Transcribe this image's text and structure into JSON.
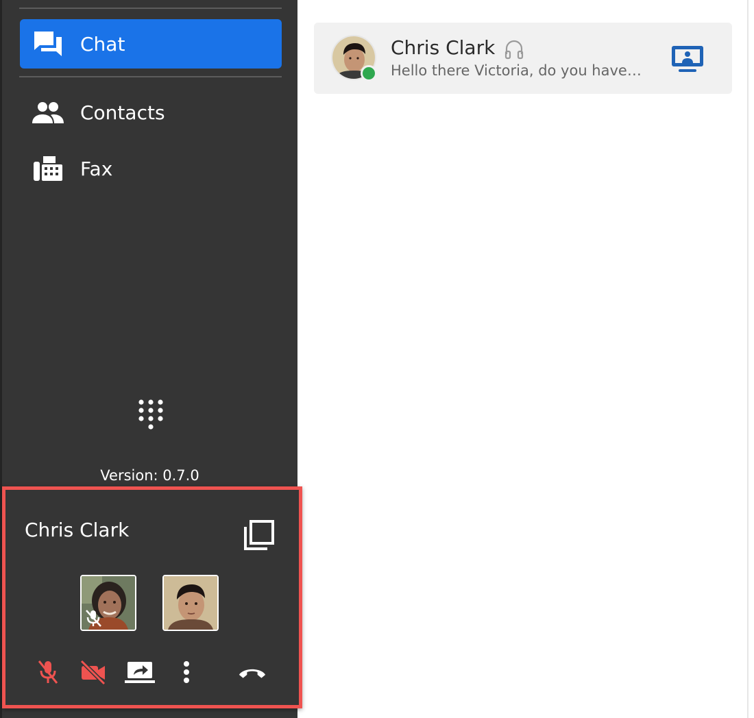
{
  "sidebar": {
    "items": [
      {
        "label": "Chat",
        "icon": "forum-icon",
        "active": true
      },
      {
        "label": "Contacts",
        "icon": "people-icon",
        "active": false
      },
      {
        "label": "Fax",
        "icon": "fax-icon",
        "active": false
      }
    ],
    "dialpad_icon": "dialpad-icon",
    "version": "Version: 0.7.0"
  },
  "call": {
    "name": "Chris Clark",
    "participants": [
      {
        "avatar": "participant-avatar-woman",
        "muted": true
      },
      {
        "avatar": "participant-avatar-man",
        "muted": false
      }
    ],
    "controls": [
      "mic-off-icon",
      "videocam-off-icon",
      "screen-share-icon",
      "more-vert-icon",
      "hang-up-icon"
    ]
  },
  "conversation": {
    "name": "Chris Clark",
    "preview": "Hello there Victoria, do you have…",
    "status": "online"
  },
  "colors": {
    "sidebar_bg": "#353535",
    "accent": "#1a73e8",
    "alert": "#ef5350",
    "presence": "#2fa84f",
    "screen_icon": "#1f63b6"
  }
}
